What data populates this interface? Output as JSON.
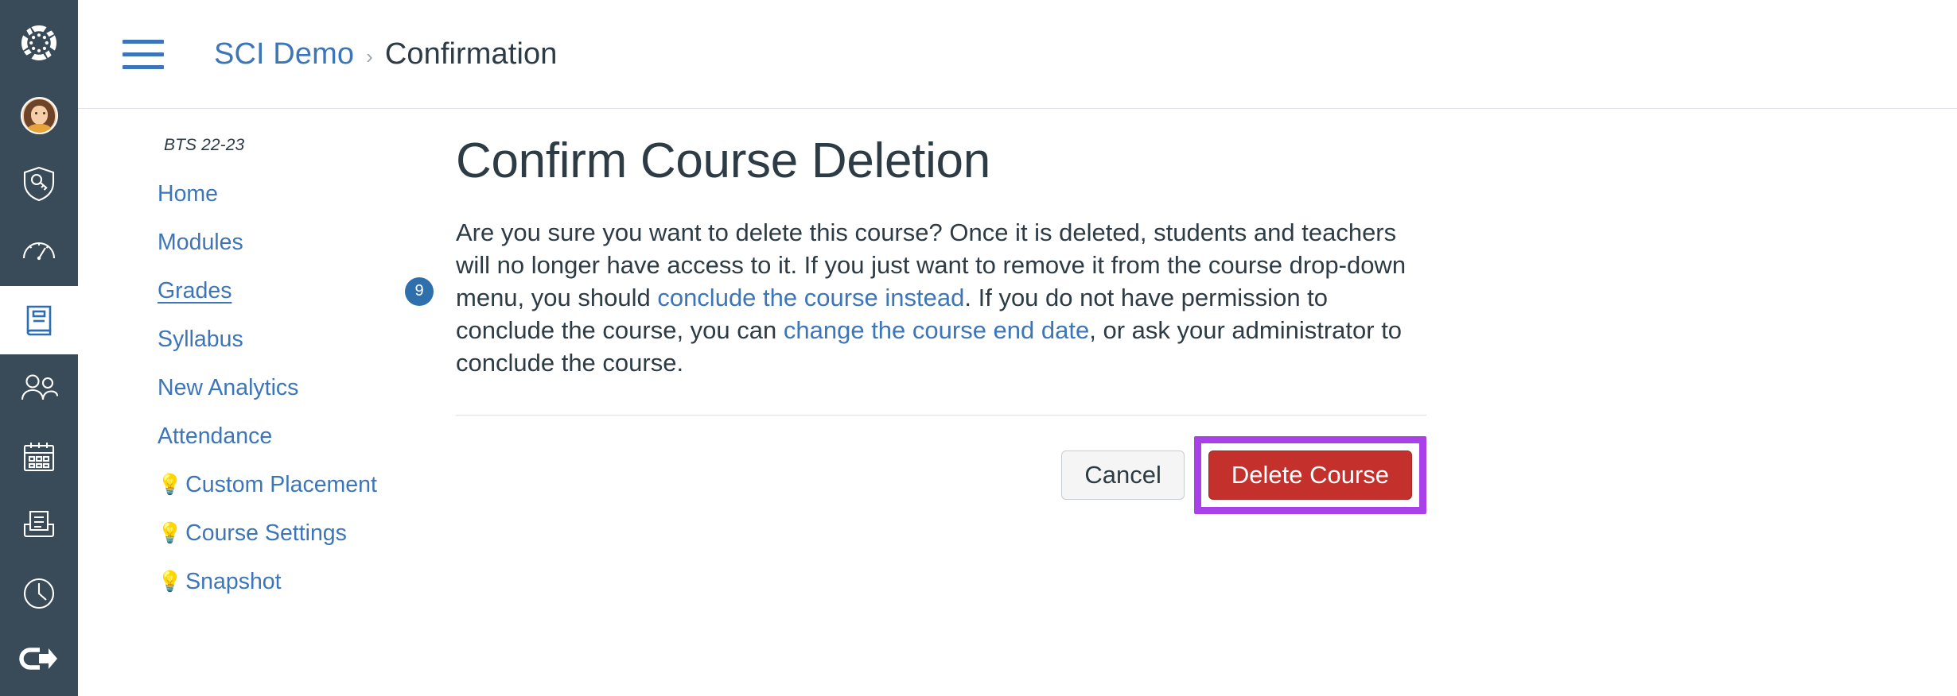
{
  "colors": {
    "global_nav_bg": "#394B58",
    "link_blue": "#3D76B8",
    "text_dark": "#2D3B45",
    "danger_red": "#C4302B",
    "highlight_purple": "#AA40E8",
    "badge_blue": "#2F6FAC",
    "divider": "#DFE3E7"
  },
  "global_nav": {
    "items": [
      {
        "name": "canvas-logo",
        "label": "Canvas",
        "icon": "canvas-logo-icon",
        "active": false
      },
      {
        "name": "account",
        "label": "Account",
        "icon": "avatar-icon",
        "active": false
      },
      {
        "name": "admin",
        "label": "Admin",
        "icon": "shield-key-icon",
        "active": false
      },
      {
        "name": "dashboard",
        "label": "Dashboard",
        "icon": "speedometer-icon",
        "active": false
      },
      {
        "name": "courses",
        "label": "Courses",
        "icon": "book-icon",
        "active": true
      },
      {
        "name": "groups",
        "label": "Groups",
        "icon": "people-icon",
        "active": false
      },
      {
        "name": "calendar",
        "label": "Calendar",
        "icon": "calendar-icon",
        "active": false
      },
      {
        "name": "inbox",
        "label": "Inbox",
        "icon": "inbox-tray-icon",
        "active": false
      },
      {
        "name": "history",
        "label": "History",
        "icon": "clock-icon",
        "active": false
      },
      {
        "name": "logout",
        "label": "Logout",
        "icon": "logout-arrow-icon",
        "active": false
      }
    ]
  },
  "topbar": {
    "menu_icon": "hamburger-menu-icon",
    "breadcrumb": {
      "course": "SCI Demo",
      "separator": "›",
      "current": "Confirmation"
    }
  },
  "course_nav": {
    "term": "BTS 22-23",
    "items": [
      {
        "label": "Home",
        "bulb": false,
        "active": false,
        "badge": null
      },
      {
        "label": "Modules",
        "bulb": false,
        "active": false,
        "badge": null
      },
      {
        "label": "Grades",
        "bulb": false,
        "active": true,
        "badge": "9"
      },
      {
        "label": "Syllabus",
        "bulb": false,
        "active": false,
        "badge": null
      },
      {
        "label": "New Analytics",
        "bulb": false,
        "active": false,
        "badge": null
      },
      {
        "label": "Attendance",
        "bulb": false,
        "active": false,
        "badge": null
      },
      {
        "label": "Custom Placement",
        "bulb": true,
        "active": false,
        "badge": null
      },
      {
        "label": "Course Settings",
        "bulb": true,
        "active": false,
        "badge": null
      },
      {
        "label": "Snapshot",
        "bulb": true,
        "active": false,
        "badge": null
      }
    ],
    "bulb_glyph": "💡"
  },
  "main": {
    "title": "Confirm Course Deletion",
    "paragraph": {
      "part1": "Are you sure you want to delete this course? Once it is deleted, students and teachers will no longer have access to it. If you just want to remove it from the course drop-down menu, you should ",
      "link1": "conclude the course instead",
      "part2": ". If you do not have permission to conclude the course, you can ",
      "link2": "change the course end date",
      "part3": ", or ask your administrator to conclude the course."
    },
    "cancel_label": "Cancel",
    "delete_label": "Delete Course"
  }
}
